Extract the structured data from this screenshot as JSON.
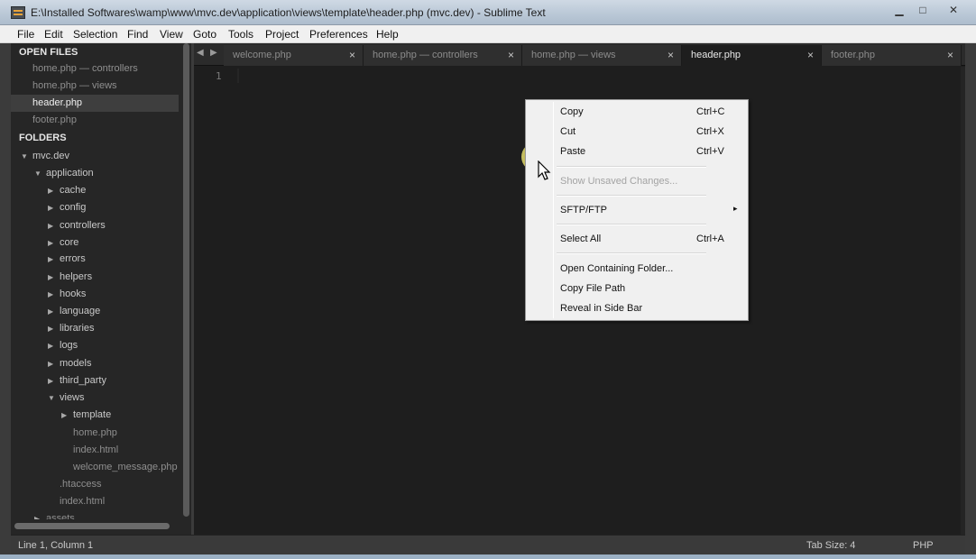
{
  "window": {
    "title": "E:\\Installed Softwares\\wamp\\www\\mvc.dev\\application\\views\\template\\header.php (mvc.dev) - Sublime Text",
    "minimize_glyph": "▁",
    "maximize_glyph": "□",
    "close_glyph": "✕"
  },
  "menubar": {
    "items": [
      "File",
      "Edit",
      "Selection",
      "Find",
      "View",
      "Goto",
      "Tools",
      "Project",
      "Preferences",
      "Help"
    ]
  },
  "sidebar": {
    "open_files_header": "OPEN FILES",
    "open_files": [
      {
        "label": "home.php — controllers",
        "selected": false
      },
      {
        "label": "home.php — views",
        "selected": false
      },
      {
        "label": "header.php",
        "selected": true
      },
      {
        "label": "footer.php",
        "selected": false
      }
    ],
    "folders_header": "FOLDERS",
    "tree": [
      {
        "label": "mvc.dev",
        "arrow": "▼"
      },
      {
        "label": "application",
        "arrow": "▼"
      },
      {
        "label": "cache",
        "arrow": "▶"
      },
      {
        "label": "config",
        "arrow": "▶"
      },
      {
        "label": "controllers",
        "arrow": "▶"
      },
      {
        "label": "core",
        "arrow": "▶"
      },
      {
        "label": "errors",
        "arrow": "▶"
      },
      {
        "label": "helpers",
        "arrow": "▶"
      },
      {
        "label": "hooks",
        "arrow": "▶"
      },
      {
        "label": "language",
        "arrow": "▶"
      },
      {
        "label": "libraries",
        "arrow": "▶"
      },
      {
        "label": "logs",
        "arrow": "▶"
      },
      {
        "label": "models",
        "arrow": "▶"
      },
      {
        "label": "third_party",
        "arrow": "▶"
      },
      {
        "label": "views",
        "arrow": "▼"
      },
      {
        "label": "template",
        "arrow": "▶"
      },
      {
        "label": "home.php",
        "arrow": ""
      },
      {
        "label": "index.html",
        "arrow": ""
      },
      {
        "label": "welcome_message.php",
        "arrow": ""
      },
      {
        "label": ".htaccess",
        "arrow": ""
      },
      {
        "label": "index.html",
        "arrow": ""
      },
      {
        "label": "assets",
        "arrow": "▶"
      }
    ]
  },
  "tabs": [
    {
      "label": "welcome.php",
      "active": false
    },
    {
      "label": "home.php — controllers",
      "active": false
    },
    {
      "label": "home.php — views",
      "active": false
    },
    {
      "label": "header.php",
      "active": true
    },
    {
      "label": "footer.php",
      "active": false
    }
  ],
  "tab_close_glyph": "×",
  "editor": {
    "line_number": "1"
  },
  "context_menu": {
    "items": [
      {
        "label": "Copy",
        "shortcut": "Ctrl+C",
        "enabled": true
      },
      {
        "label": "Cut",
        "shortcut": "Ctrl+X",
        "enabled": true
      },
      {
        "label": "Paste",
        "shortcut": "Ctrl+V",
        "enabled": true
      },
      {
        "label": "Show Unsaved Changes...",
        "shortcut": "",
        "enabled": false
      },
      {
        "label": "SFTP/FTP",
        "shortcut": "",
        "enabled": true,
        "submenu": "▸"
      },
      {
        "label": "Select All",
        "shortcut": "Ctrl+A",
        "enabled": true
      },
      {
        "label": "Open Containing Folder...",
        "shortcut": "",
        "enabled": true
      },
      {
        "label": "Copy File Path",
        "shortcut": "",
        "enabled": true
      },
      {
        "label": "Reveal in Side Bar",
        "shortcut": "",
        "enabled": true
      }
    ]
  },
  "statusbar": {
    "position": "Line 1, Column 1",
    "tab_size": "Tab Size: 4",
    "syntax": "PHP"
  },
  "colors": {
    "editor_bg": "#1e1e1e",
    "sidebar_bg": "#262626",
    "menu_bg": "#f0f0f0",
    "titlebar_bg": "#b9c7d6"
  },
  "icons": [
    "app-icon",
    "minimize-icon",
    "maximize-icon",
    "close-icon",
    "tab-nav-left-icon",
    "tab-nav-right-icon",
    "tab-close-icon",
    "folder-expand-arrow-icon",
    "submenu-arrow-icon",
    "mouse-pointer-icon"
  ]
}
